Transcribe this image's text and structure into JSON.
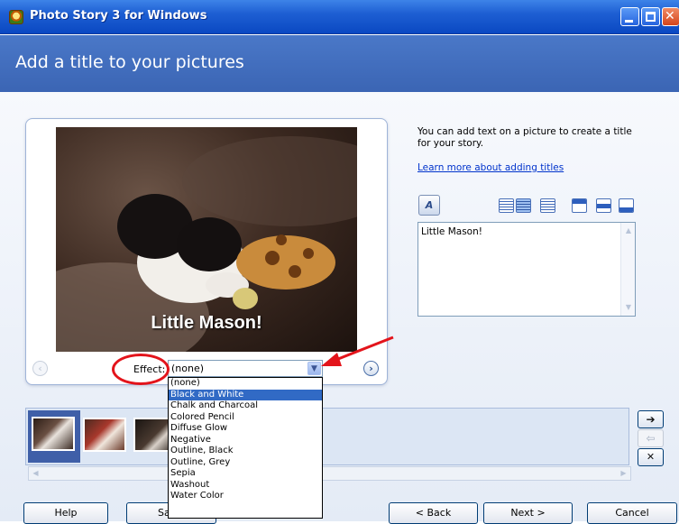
{
  "window": {
    "title": "Photo Story 3 for Windows",
    "controls": [
      "minimize-icon",
      "maximize-icon",
      "close-icon"
    ]
  },
  "header": {
    "title": "Add a title to your pictures"
  },
  "preview": {
    "caption": "Little Mason!",
    "effect_label": "Effect:",
    "effect_value": "(none)",
    "prev_icon": "chevron-left-icon",
    "next_icon": "chevron-right-icon"
  },
  "effect_dropdown": {
    "options": [
      "(none)",
      "Black and White",
      "Chalk and Charcoal",
      "Colored Pencil",
      "Diffuse Glow",
      "Negative",
      "Outline, Black",
      "Outline, Grey",
      "Sepia",
      "Washout",
      "Water Color"
    ],
    "highlighted": "Black and White"
  },
  "info": {
    "text": "You can add text on a picture to create a title for your story.",
    "link": "Learn more about adding titles"
  },
  "text_tools": {
    "icons": [
      "font-icon",
      "align-left-icon",
      "align-center-icon",
      "align-right-icon",
      "position-top-icon",
      "position-middle-icon",
      "position-bottom-icon"
    ],
    "active_alignment": "center"
  },
  "title_text": {
    "value": "Little Mason!"
  },
  "filmstrip": {
    "thumbnails": 3,
    "selected_index": 0
  },
  "side_buttons": {
    "move_right_icon": "arrow-right-icon",
    "move_left_icon": "arrow-left-icon",
    "remove_icon": "remove-x-icon"
  },
  "footer": {
    "help": "Help",
    "save_partial": "Sa",
    "back": "< Back",
    "next": "Next >",
    "cancel": "Cancel"
  },
  "colors": {
    "titlebar": "#1e5fd3",
    "header": "#4a78c8",
    "selection": "#316ac5",
    "annotation_red": "#e3141b",
    "link": "#0033cc"
  }
}
